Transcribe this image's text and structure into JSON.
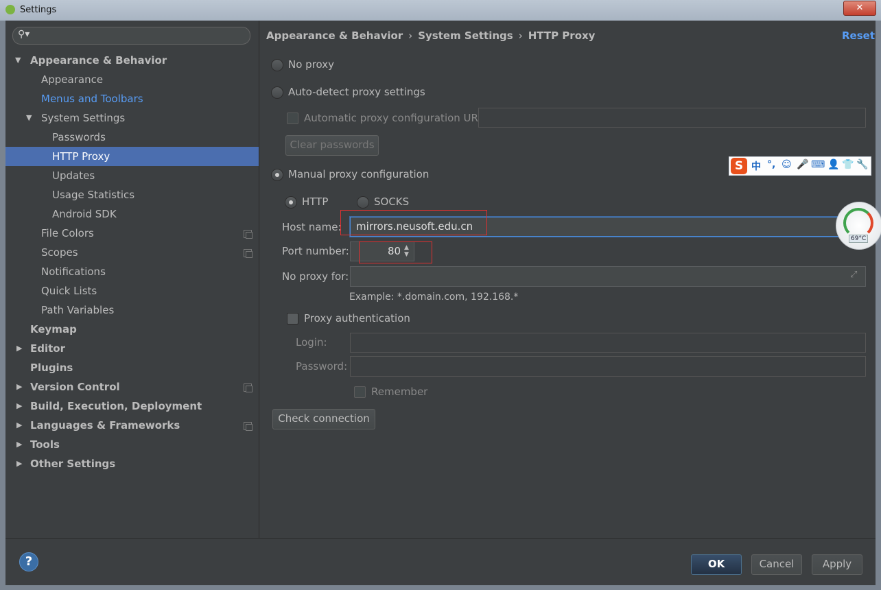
{
  "window": {
    "title": "Settings",
    "close": "✕"
  },
  "sidebar": {
    "search_icon": "search-icon",
    "items": [
      {
        "label": "Appearance & Behavior"
      },
      {
        "label": "Appearance"
      },
      {
        "label": "Menus and Toolbars"
      },
      {
        "label": "System Settings"
      },
      {
        "label": "Passwords"
      },
      {
        "label": "HTTP Proxy"
      },
      {
        "label": "Updates"
      },
      {
        "label": "Usage Statistics"
      },
      {
        "label": "Android SDK"
      },
      {
        "label": "File Colors"
      },
      {
        "label": "Scopes"
      },
      {
        "label": "Notifications"
      },
      {
        "label": "Quick Lists"
      },
      {
        "label": "Path Variables"
      },
      {
        "label": "Keymap"
      },
      {
        "label": "Editor"
      },
      {
        "label": "Plugins"
      },
      {
        "label": "Version Control"
      },
      {
        "label": "Build, Execution, Deployment"
      },
      {
        "label": "Languages & Frameworks"
      },
      {
        "label": "Tools"
      },
      {
        "label": "Other Settings"
      }
    ],
    "selected": "HTTP Proxy"
  },
  "breadcrumb": {
    "part1": "Appearance & Behavior",
    "part2": "System Settings",
    "part3": "HTTP Proxy",
    "sep": "›"
  },
  "reset_label": "Reset",
  "proxy": {
    "no_proxy": "No proxy",
    "auto_detect": "Auto-detect proxy settings",
    "auto_url_label": "Automatic proxy configuration URL:",
    "clear_passwords": "Clear passwords",
    "manual": "Manual proxy configuration",
    "selected_mode": "manual",
    "http": "HTTP",
    "socks": "SOCKS",
    "protocol": "HTTP",
    "host_label": "Host name:",
    "host_value": "mirrors.neusoft.edu.cn",
    "port_label": "Port number:",
    "port_value": "80",
    "no_proxy_for_label": "No proxy for:",
    "no_proxy_for_value": "",
    "example": "Example: *.domain.com, 192.168.*",
    "proxy_auth": "Proxy authentication",
    "login_label": "Login:",
    "password_label": "Password:",
    "remember": "Remember",
    "check_connection": "Check connection"
  },
  "footer": {
    "help": "?",
    "ok": "OK",
    "cancel": "Cancel",
    "apply": "Apply"
  },
  "ime_bar": {
    "logo": "S",
    "glyphs": [
      "中",
      "°,",
      "☺",
      "🎤",
      "⌨",
      "👤",
      "👕",
      "🔧"
    ]
  },
  "gauge": {
    "temp": "69°C"
  },
  "colors": {
    "accent": "#589df6",
    "selection": "#4b6eaf",
    "background": "#3c3f41",
    "highlight_box": "#e03030"
  }
}
